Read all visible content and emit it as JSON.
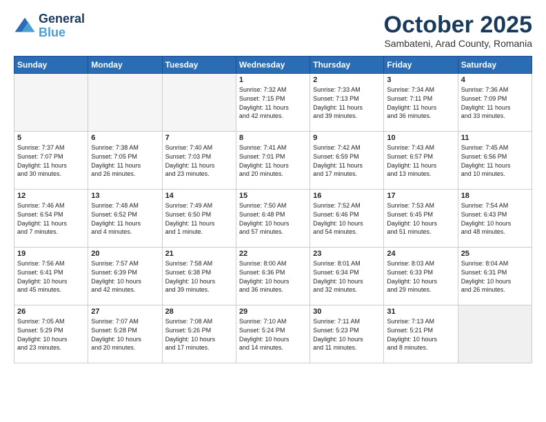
{
  "header": {
    "logo_line1": "General",
    "logo_line2": "Blue",
    "month": "October 2025",
    "location": "Sambateni, Arad County, Romania"
  },
  "weekdays": [
    "Sunday",
    "Monday",
    "Tuesday",
    "Wednesday",
    "Thursday",
    "Friday",
    "Saturday"
  ],
  "weeks": [
    [
      {
        "day": "",
        "info": ""
      },
      {
        "day": "",
        "info": ""
      },
      {
        "day": "",
        "info": ""
      },
      {
        "day": "1",
        "info": "Sunrise: 7:32 AM\nSunset: 7:15 PM\nDaylight: 11 hours\nand 42 minutes."
      },
      {
        "day": "2",
        "info": "Sunrise: 7:33 AM\nSunset: 7:13 PM\nDaylight: 11 hours\nand 39 minutes."
      },
      {
        "day": "3",
        "info": "Sunrise: 7:34 AM\nSunset: 7:11 PM\nDaylight: 11 hours\nand 36 minutes."
      },
      {
        "day": "4",
        "info": "Sunrise: 7:36 AM\nSunset: 7:09 PM\nDaylight: 11 hours\nand 33 minutes."
      }
    ],
    [
      {
        "day": "5",
        "info": "Sunrise: 7:37 AM\nSunset: 7:07 PM\nDaylight: 11 hours\nand 30 minutes."
      },
      {
        "day": "6",
        "info": "Sunrise: 7:38 AM\nSunset: 7:05 PM\nDaylight: 11 hours\nand 26 minutes."
      },
      {
        "day": "7",
        "info": "Sunrise: 7:40 AM\nSunset: 7:03 PM\nDaylight: 11 hours\nand 23 minutes."
      },
      {
        "day": "8",
        "info": "Sunrise: 7:41 AM\nSunset: 7:01 PM\nDaylight: 11 hours\nand 20 minutes."
      },
      {
        "day": "9",
        "info": "Sunrise: 7:42 AM\nSunset: 6:59 PM\nDaylight: 11 hours\nand 17 minutes."
      },
      {
        "day": "10",
        "info": "Sunrise: 7:43 AM\nSunset: 6:57 PM\nDaylight: 11 hours\nand 13 minutes."
      },
      {
        "day": "11",
        "info": "Sunrise: 7:45 AM\nSunset: 6:56 PM\nDaylight: 11 hours\nand 10 minutes."
      }
    ],
    [
      {
        "day": "12",
        "info": "Sunrise: 7:46 AM\nSunset: 6:54 PM\nDaylight: 11 hours\nand 7 minutes."
      },
      {
        "day": "13",
        "info": "Sunrise: 7:48 AM\nSunset: 6:52 PM\nDaylight: 11 hours\nand 4 minutes."
      },
      {
        "day": "14",
        "info": "Sunrise: 7:49 AM\nSunset: 6:50 PM\nDaylight: 11 hours\nand 1 minute."
      },
      {
        "day": "15",
        "info": "Sunrise: 7:50 AM\nSunset: 6:48 PM\nDaylight: 10 hours\nand 57 minutes."
      },
      {
        "day": "16",
        "info": "Sunrise: 7:52 AM\nSunset: 6:46 PM\nDaylight: 10 hours\nand 54 minutes."
      },
      {
        "day": "17",
        "info": "Sunrise: 7:53 AM\nSunset: 6:45 PM\nDaylight: 10 hours\nand 51 minutes."
      },
      {
        "day": "18",
        "info": "Sunrise: 7:54 AM\nSunset: 6:43 PM\nDaylight: 10 hours\nand 48 minutes."
      }
    ],
    [
      {
        "day": "19",
        "info": "Sunrise: 7:56 AM\nSunset: 6:41 PM\nDaylight: 10 hours\nand 45 minutes."
      },
      {
        "day": "20",
        "info": "Sunrise: 7:57 AM\nSunset: 6:39 PM\nDaylight: 10 hours\nand 42 minutes."
      },
      {
        "day": "21",
        "info": "Sunrise: 7:58 AM\nSunset: 6:38 PM\nDaylight: 10 hours\nand 39 minutes."
      },
      {
        "day": "22",
        "info": "Sunrise: 8:00 AM\nSunset: 6:36 PM\nDaylight: 10 hours\nand 36 minutes."
      },
      {
        "day": "23",
        "info": "Sunrise: 8:01 AM\nSunset: 6:34 PM\nDaylight: 10 hours\nand 32 minutes."
      },
      {
        "day": "24",
        "info": "Sunrise: 8:03 AM\nSunset: 6:33 PM\nDaylight: 10 hours\nand 29 minutes."
      },
      {
        "day": "25",
        "info": "Sunrise: 8:04 AM\nSunset: 6:31 PM\nDaylight: 10 hours\nand 26 minutes."
      }
    ],
    [
      {
        "day": "26",
        "info": "Sunrise: 7:05 AM\nSunset: 5:29 PM\nDaylight: 10 hours\nand 23 minutes."
      },
      {
        "day": "27",
        "info": "Sunrise: 7:07 AM\nSunset: 5:28 PM\nDaylight: 10 hours\nand 20 minutes."
      },
      {
        "day": "28",
        "info": "Sunrise: 7:08 AM\nSunset: 5:26 PM\nDaylight: 10 hours\nand 17 minutes."
      },
      {
        "day": "29",
        "info": "Sunrise: 7:10 AM\nSunset: 5:24 PM\nDaylight: 10 hours\nand 14 minutes."
      },
      {
        "day": "30",
        "info": "Sunrise: 7:11 AM\nSunset: 5:23 PM\nDaylight: 10 hours\nand 11 minutes."
      },
      {
        "day": "31",
        "info": "Sunrise: 7:13 AM\nSunset: 5:21 PM\nDaylight: 10 hours\nand 8 minutes."
      },
      {
        "day": "",
        "info": ""
      }
    ]
  ]
}
